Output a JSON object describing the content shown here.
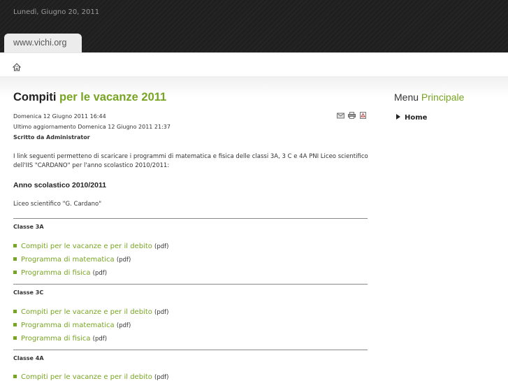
{
  "header": {
    "date": "Lunedì, Giugno 20, 2011",
    "site_tab": "www.vichi.org"
  },
  "breadcrumb": {
    "home_icon": "home-icon"
  },
  "article": {
    "title_part1": "Compiti",
    "title_part2": "per le vacanze 2011",
    "created": "Domenica 12 Giugno 2011 16:44",
    "updated": "Ultimo aggiornamento Domenica 12 Giugno 2011 21:37",
    "author": "Scritto da Administrator",
    "tools": [
      "email-icon",
      "print-icon",
      "pdf-icon"
    ],
    "intro": "I link seguenti permetteno di scaricare i programmi di matematica e fisica delle classi 3A, 3 C e 4A PNI  Liceo scientifico dell'IIS \"CARDANO\" per l'anno scolastico 2010/2011:",
    "year_heading": "Anno scolastico 2010/2011",
    "school": "Liceo scientifico \"G. Cardano\"",
    "classes": [
      {
        "name": "Classe 3A",
        "items": [
          {
            "label": "Compiti per le vacanze e per il debito",
            "note": "(pdf)"
          },
          {
            "label": "Programma di matematica",
            "note": "(pdf)"
          },
          {
            "label": "Programma di fisica",
            "note": "(pdf)"
          }
        ]
      },
      {
        "name": "Classe 3C",
        "items": [
          {
            "label": "Compiti per le vacanze e per il debito",
            "note": "(pdf)"
          },
          {
            "label": "Programma di matematica",
            "note": "(pdf)"
          },
          {
            "label": "Programma di fisica",
            "note": "(pdf)"
          }
        ]
      },
      {
        "name": "Classe 4A",
        "items": [
          {
            "label": "Compiti per le vacanze e per il debito",
            "note": "(pdf)"
          }
        ]
      }
    ]
  },
  "sidebar": {
    "menu_title_part1": "Menu",
    "menu_title_part2": "Principale",
    "items": [
      {
        "label": "Home"
      }
    ]
  },
  "colors": {
    "accent": "#77a422",
    "header_bg": "#1f1f1f"
  }
}
